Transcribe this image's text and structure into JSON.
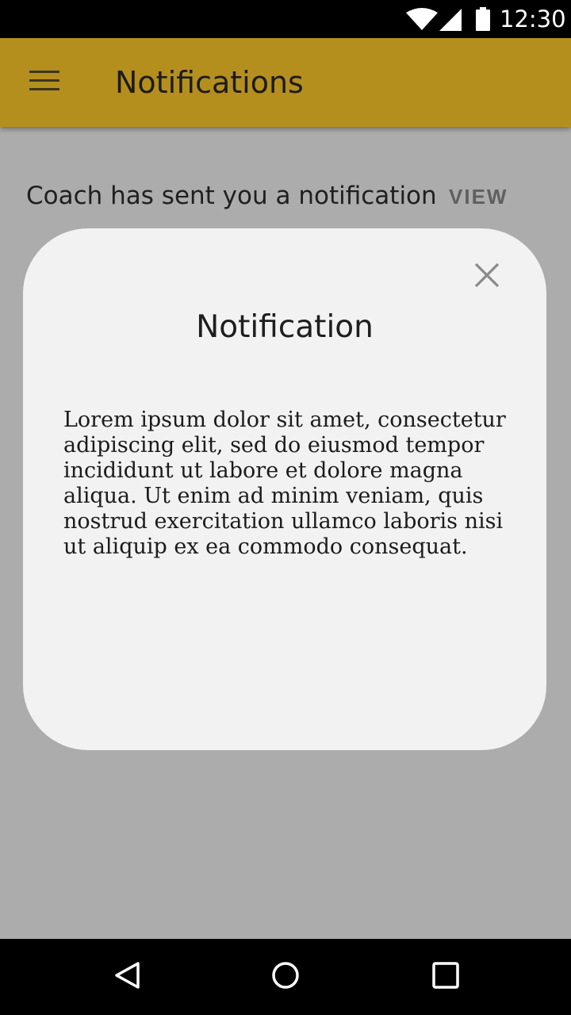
{
  "status_bar": {
    "time": "12:30",
    "icons": [
      "wifi-icon",
      "signal-icon",
      "battery-icon"
    ]
  },
  "app_bar": {
    "title": "Notifications",
    "menu_icon": "hamburger-menu-icon",
    "color": "#b58f1e"
  },
  "notification_row": {
    "text": "Coach has sent you a notification",
    "action_label": "VIEW"
  },
  "dialog": {
    "title": "Notification",
    "body": "Lorem ipsum dolor sit amet, consectetur adipiscing elit, sed do eiusmod tempor incididunt ut labore et dolore magna aliqua. Ut enim ad minim veniam, quis nostrud exercitation ullamco laboris nisi ut aliquip ex ea commodo consequat.",
    "close_icon": "close-icon"
  },
  "nav_bar": {
    "icons": [
      "back-icon",
      "home-icon",
      "recents-icon"
    ]
  }
}
